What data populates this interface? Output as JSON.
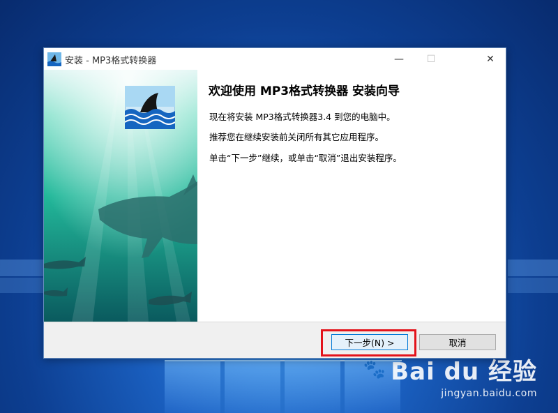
{
  "window": {
    "title": "安装 - MP3格式转换器",
    "controls": {
      "minimize": "—",
      "maximize": "☐",
      "close": "✕"
    }
  },
  "wizard": {
    "heading": "欢迎使用 MP3格式转换器 安装向导",
    "line1": "现在将安装 MP3格式转换器3.4 到您的电脑中。",
    "line2": "推荐您在继续安装前关闭所有其它应用程序。",
    "line3": "单击“下一步”继续，或单击“取消”退出安装程序。"
  },
  "buttons": {
    "next": "下一步(N) >",
    "cancel": "取消"
  },
  "watermark": {
    "logo": "Bai du 经验",
    "url": "jingyan.baidu.com"
  },
  "colors": {
    "highlight": "#e3131b",
    "focus_border": "#0078d7"
  }
}
